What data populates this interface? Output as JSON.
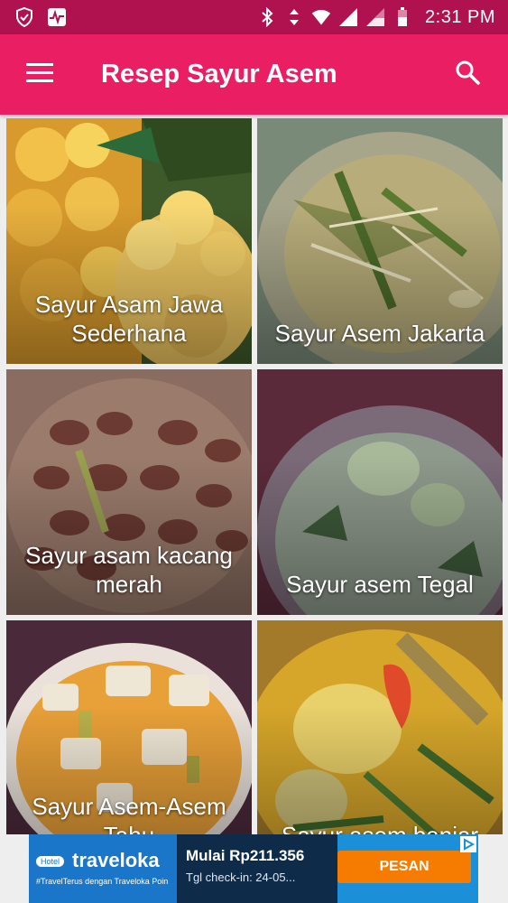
{
  "status_bar": {
    "time": "2:31 PM",
    "icons": [
      "shield-icon",
      "activity-icon",
      "bluetooth-icon",
      "data-arrows-icon",
      "wifi-icon",
      "signal-icon",
      "signal-icon-2",
      "battery-icon"
    ]
  },
  "app_bar": {
    "title": "Resep Sayur Asem",
    "menu_icon": "hamburger-menu-icon",
    "search_icon": "search-icon"
  },
  "recipes": [
    {
      "title": "Sayur Asam Jawa Sederhana"
    },
    {
      "title": "Sayur Asem Jakarta"
    },
    {
      "title": "Sayur asam kacang merah"
    },
    {
      "title": "Sayur asem Tegal"
    },
    {
      "title": "Sayur Asem-Asem Tahu"
    },
    {
      "title": "Sayur asem banjar"
    }
  ],
  "ad": {
    "badge": "Hotel",
    "brand": "traveloka",
    "tagline": "#TravelTerus dengan Traveloka Poin",
    "headline": "Mulai Rp211.356",
    "subtext": "Tgl check-in: 24-05...",
    "cta": "PESAN",
    "adchoices_icon": "adchoices-icon"
  },
  "colors": {
    "status_bar": "#b0114f",
    "app_bar": "#e91e63",
    "ad_blue": "#1b8fd8",
    "ad_orange": "#f57c00"
  }
}
